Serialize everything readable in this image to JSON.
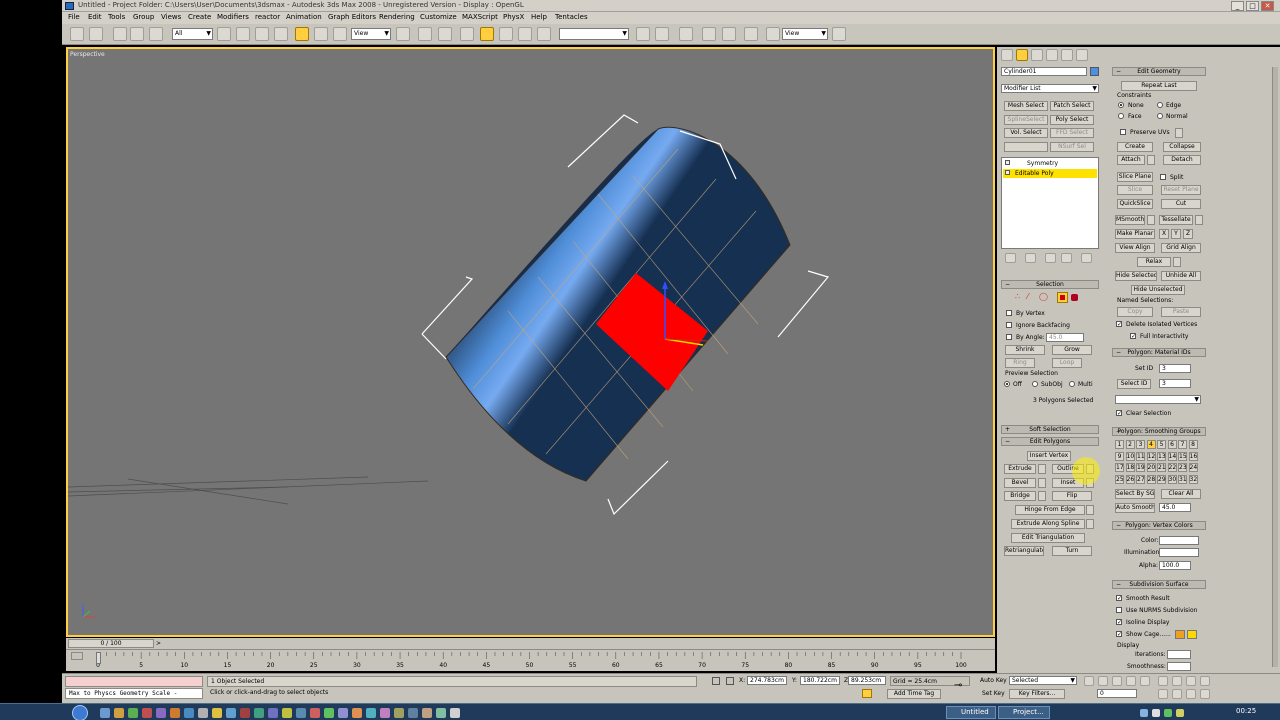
{
  "window": {
    "title": "Untitled     - Project Folder: C:\\Users\\User\\Documents\\3dsmax     - Autodesk 3ds Max 2008     - Unregistered Version     - Display : OpenGL"
  },
  "menu": [
    "File",
    "Edit",
    "Tools",
    "Group",
    "Views",
    "Create",
    "Modifiers",
    "reactor",
    "Animation",
    "Graph Editors",
    "Rendering",
    "Customize",
    "MAXScript",
    "PhysX",
    "Help",
    "Tentacles"
  ],
  "toolbar": {
    "selection_filter": "All",
    "ref_coord": "View",
    "named_sel": "",
    "view_dd2": "View"
  },
  "viewport": {
    "label": "Perspective"
  },
  "command_panel": {
    "object_name": "Cylinder01",
    "object_color": "#4f8fe0",
    "modifier_list": "Modifier List",
    "modifier_buttons": [
      "Mesh Select",
      "Patch Select",
      "SplineSelect",
      "Poly Select",
      "Vol. Select",
      "FFD Select",
      "",
      "NSurf Sel"
    ],
    "stack": [
      "Symmetry",
      "Editable Poly"
    ],
    "selection": {
      "header": "Selection",
      "by_vertex": "By Vertex",
      "ignore_backfacing": "Ignore Backfacing",
      "by_angle": "By Angle:",
      "angle_value": "45.0",
      "shrink": "Shrink",
      "grow": "Grow",
      "ring": "Ring",
      "loop": "Loop",
      "preview_selection": "Preview Selection",
      "preview_off": "Off",
      "preview_subobj": "SubObj",
      "preview_multi": "Multi",
      "status": "3 Polygons Selected"
    },
    "soft_selection": "Soft Selection",
    "edit_polygons": {
      "header": "Edit Polygons",
      "insert_vertex": "Insert Vertex",
      "extrude": "Extrude",
      "outline": "Outline",
      "bevel": "Bevel",
      "inset": "Inset",
      "bridge": "Bridge",
      "flip": "Flip",
      "hinge": "Hinge From Edge",
      "extrude_spline": "Extrude Along Spline",
      "edit_triangulation": "Edit Triangulation",
      "retriangulate": "Retriangulate",
      "turn": "Turn"
    },
    "edit_geometry": {
      "header": "Edit Geometry",
      "repeat_last": "Repeat Last",
      "constraints": "Constraints",
      "c_none": "None",
      "c_edge": "Edge",
      "c_face": "Face",
      "c_normal": "Normal",
      "preserve_uvs": "Preserve UVs",
      "create": "Create",
      "collapse": "Collapse",
      "attach": "Attach",
      "detach": "Detach",
      "slice_plane": "Slice Plane",
      "split": "Split",
      "slice": "Slice",
      "reset_plane": "Reset Plane",
      "quickslice": "QuickSlice",
      "cut": "Cut",
      "msmooth": "MSmooth",
      "tessellate": "Tessellate",
      "make_planar": "Make Planar",
      "x": "X",
      "y": "Y",
      "z": "Z",
      "view_align": "View Align",
      "grid_align": "Grid Align",
      "relax": "Relax",
      "hide_selected": "Hide Selected",
      "unhide_all": "Unhide All",
      "hide_unselected": "Hide Unselected",
      "named_selections": "Named Selections:",
      "copy": "Copy",
      "paste": "Paste",
      "delete_isolated": "Delete Isolated Vertices",
      "full_interactivity": "Full Interactivity"
    },
    "material_ids": {
      "header": "Polygon: Material IDs",
      "set_id": "Set ID",
      "set_id_val": "3",
      "select_id": "Select ID",
      "select_id_val": "3",
      "clear_selection": "Clear Selection"
    },
    "smoothing_groups": {
      "header": "Polygon: Smoothing Groups",
      "numbers": [
        "1",
        "2",
        "3",
        "4",
        "5",
        "6",
        "7",
        "8",
        "9",
        "10",
        "11",
        "12",
        "13",
        "14",
        "15",
        "16",
        "17",
        "18",
        "19",
        "20",
        "21",
        "22",
        "23",
        "24",
        "25",
        "26",
        "27",
        "28",
        "29",
        "30",
        "31",
        "32"
      ],
      "select_by_sg": "Select By SG",
      "clear_all": "Clear All",
      "auto_smooth": "Auto Smooth",
      "auto_smooth_val": "45.0"
    },
    "vertex_colors": {
      "header": "Polygon: Vertex Colors",
      "color": "Color:",
      "illumination": "Illumination:",
      "alpha": "Alpha:",
      "alpha_val": "100.0"
    },
    "subdivision": {
      "header": "Subdivision Surface",
      "smooth_result": "Smooth Result",
      "use_nurms": "Use NURMS Subdivision",
      "isoline": "Isoline Display",
      "show_cage": "Show Cage......",
      "display": "Display",
      "iterations": "Iterations:",
      "smoothness": "Smoothness:"
    }
  },
  "timeline": {
    "frame": "0 / 100",
    "ticks": [
      "0",
      "5",
      "10",
      "15",
      "20",
      "25",
      "30",
      "35",
      "40",
      "45",
      "50",
      "55",
      "60",
      "65",
      "70",
      "75",
      "80",
      "85",
      "90",
      "95",
      "100"
    ]
  },
  "status": {
    "maxscript": "Max to Physcs Geometry Scale -",
    "objects_selected": "1 Object Selected",
    "prompt": "Click or click-and-drag to select objects",
    "x": "274.783cm",
    "y": "180.722cm",
    "z": "89.253cm",
    "grid": "Grid = 25.4cm",
    "add_time_tag": "Add Time Tag",
    "auto_key": "Auto Key",
    "auto_key_dd": "Selected",
    "set_key": "Set Key",
    "key_filters": "Key Filters...",
    "current_frame": "0"
  },
  "taskbar": {
    "items": [
      "Untitled",
      "Project..."
    ],
    "clock": "00:25"
  }
}
